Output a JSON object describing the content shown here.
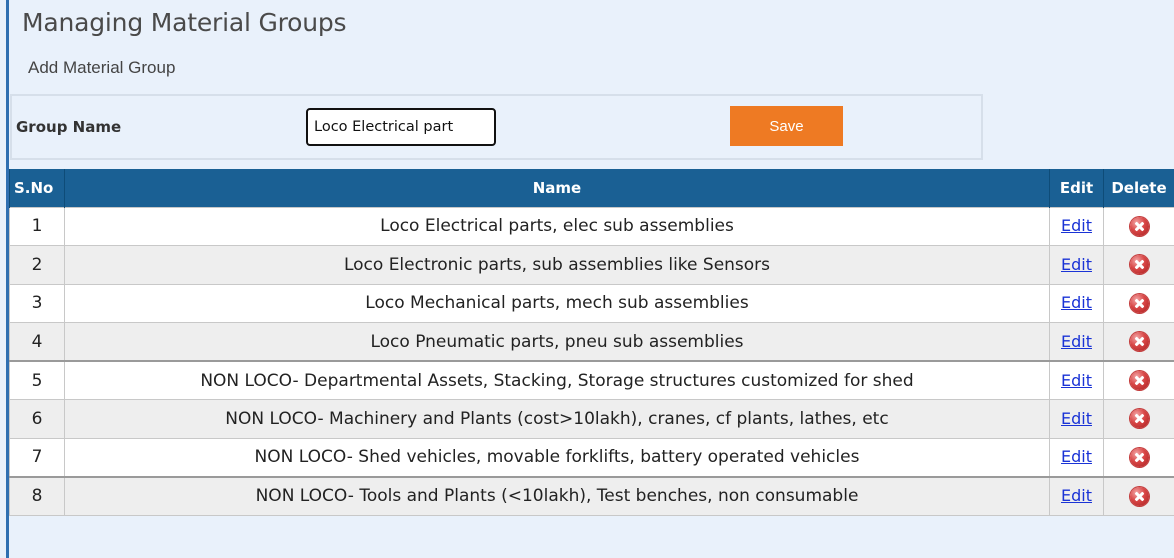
{
  "page": {
    "title": "Managing Material Groups",
    "subtitle": "Add Material Group"
  },
  "form": {
    "group_name_label": "Group Name",
    "group_name_value": "Loco Electrical part",
    "save_label": "Save"
  },
  "table": {
    "columns": [
      "S.No",
      "Name",
      "Edit",
      "Delete"
    ],
    "rows": [
      {
        "sno": "1",
        "name": "Loco Electrical parts, elec sub assemblies",
        "edit": "Edit"
      },
      {
        "sno": "2",
        "name": "Loco Electronic parts, sub assemblies like Sensors",
        "edit": "Edit"
      },
      {
        "sno": "3",
        "name": "Loco Mechanical parts, mech sub assemblies",
        "edit": "Edit"
      },
      {
        "sno": "4",
        "name": "Loco Pneumatic parts, pneu sub assemblies",
        "edit": "Edit"
      },
      {
        "sno": "5",
        "name": "NON LOCO- Departmental Assets, Stacking, Storage structures customized for shed",
        "edit": "Edit"
      },
      {
        "sno": "6",
        "name": "NON LOCO- Machinery and Plants (cost>10lakh), cranes, cf plants, lathes, etc",
        "edit": "Edit"
      },
      {
        "sno": "7",
        "name": "NON LOCO- Shed vehicles, movable forklifts, battery operated vehicles",
        "edit": "Edit"
      },
      {
        "sno": "8",
        "name": "NON LOCO- Tools and Plants (<10lakh), Test benches, non consumable",
        "edit": "Edit"
      }
    ]
  },
  "icons": {
    "delete": "delete-icon"
  },
  "colors": {
    "header_bg": "#1a6094",
    "save_button": "#ee7a23",
    "page_bg": "#e9f1fb",
    "link": "#1a33d6"
  }
}
